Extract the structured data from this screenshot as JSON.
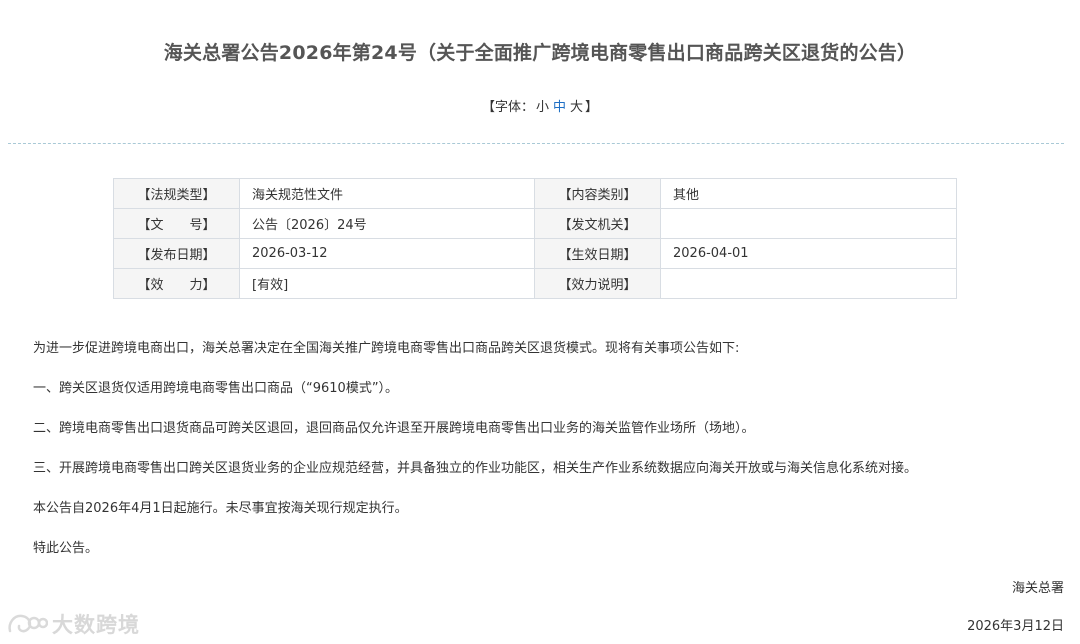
{
  "title": "海关总署公告2026年第24号（关于全面推广跨境电商零售出口商品跨关区退货的公告）",
  "font_size": {
    "prefix": "【字体：",
    "small": "小",
    "medium": "中",
    "large": "大",
    "suffix": "】",
    "selected": "中"
  },
  "meta": {
    "rows": [
      {
        "k1": "【法规类型】",
        "v1": "海关规范性文件",
        "k2": "【内容类别】",
        "v2": "其他"
      },
      {
        "k1": "【文　　号】",
        "v1": "公告〔2026〕24号",
        "k2": "【发文机关】",
        "v2": ""
      },
      {
        "k1": "【发布日期】",
        "v1": "2026-03-12",
        "k2": "【生效日期】",
        "v2": "2026-04-01"
      },
      {
        "k1": "【效　　力】",
        "v1": "[有效]",
        "k2": "【效力说明】",
        "v2": ""
      }
    ]
  },
  "body": {
    "p0": "为进一步促进跨境电商出口，海关总署决定在全国海关推广跨境电商零售出口商品跨关区退货模式。现将有关事项公告如下:",
    "p1": "一、跨关区退货仅适用跨境电商零售出口商品（“9610模式”）。",
    "p2": "二、跨境电商零售出口退货商品可跨关区退回，退回商品仅允许退至开展跨境电商零售出口业务的海关监管作业场所（场地）。",
    "p3": "三、开展跨境电商零售出口跨关区退货业务的企业应规范经营，并具备独立的作业功能区，相关生产作业系统数据应向海关开放或与海关信息化系统对接。",
    "p4": "本公告自2026年4月1日起施行。未尽事宜按海关现行规定执行。",
    "p5": "特此公告。"
  },
  "signature": {
    "org": "海关总署",
    "date": "2026年3月12日"
  },
  "watermark": {
    "text": "大数跨境"
  }
}
